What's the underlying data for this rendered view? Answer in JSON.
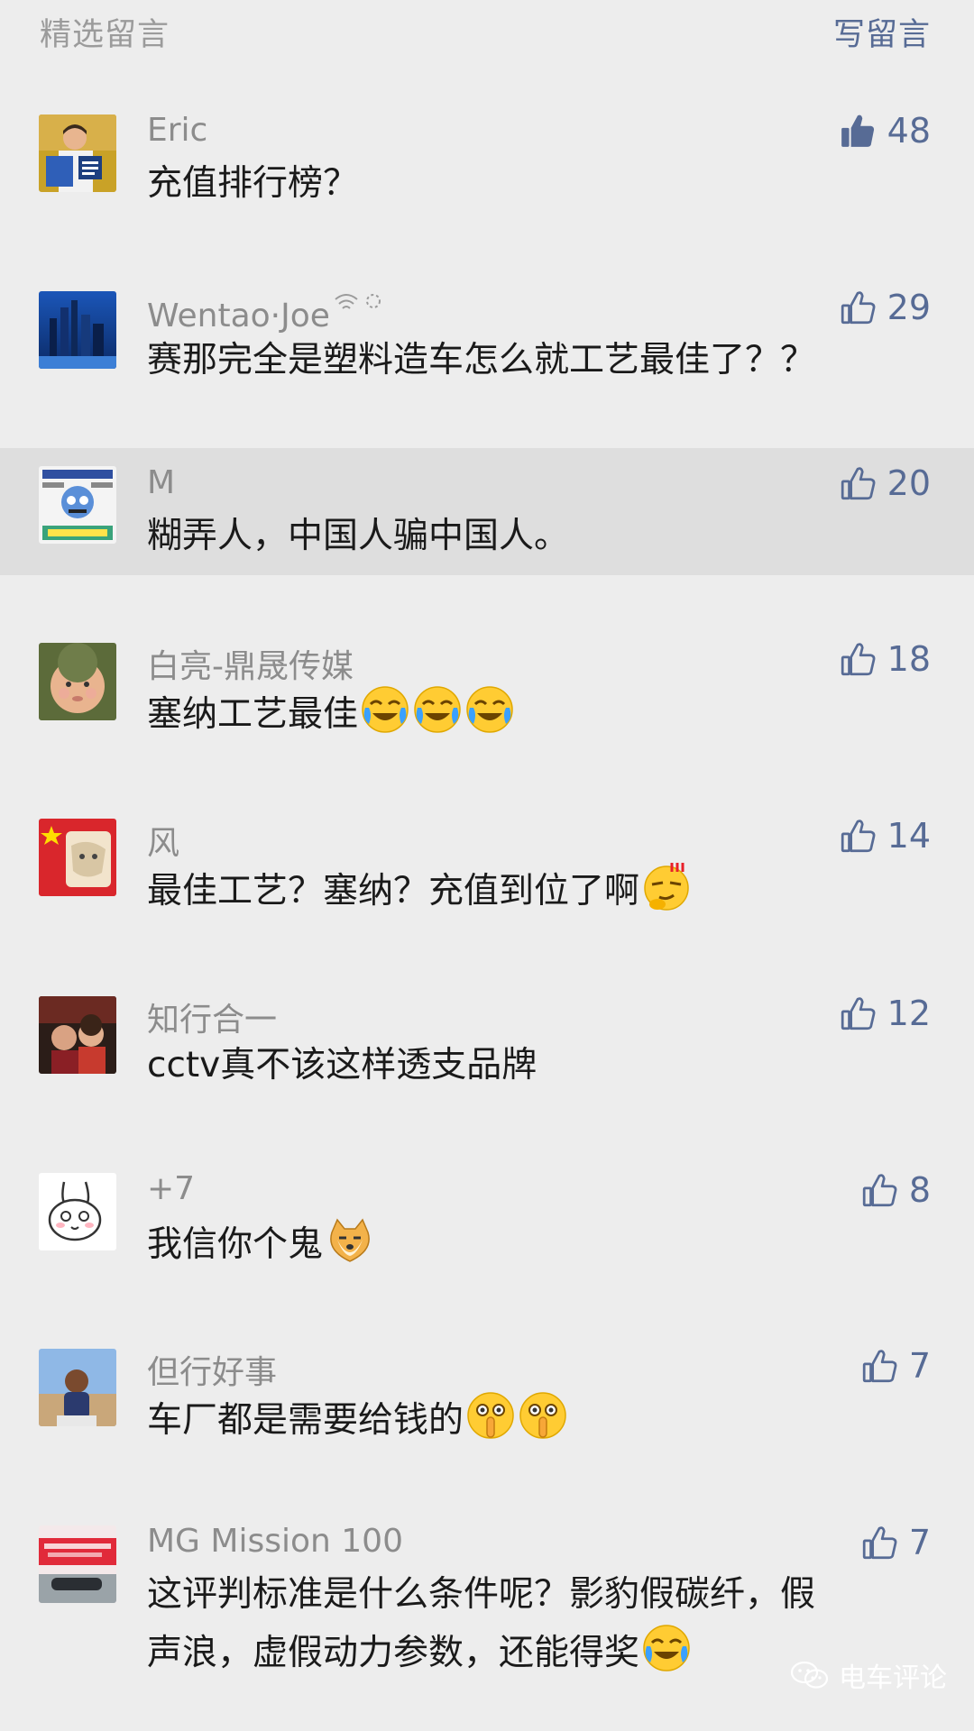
{
  "header": {
    "title": "精选留言",
    "write_label": "写留言"
  },
  "comments": [
    {
      "nickname": "Eric",
      "text": "充值排行榜？",
      "likes": "48",
      "liked": true
    },
    {
      "nickname": "Wentao·Joe",
      "text": "赛那完全是塑料造车怎么就工艺最佳了？？",
      "likes": "29",
      "liked": false
    },
    {
      "nickname": "M",
      "text": "糊弄人，中国人骗中国人。",
      "likes": "20",
      "liked": false
    },
    {
      "nickname": "白亮-鼎晟传媒",
      "text": "塞纳工艺最佳",
      "likes": "18",
      "liked": false
    },
    {
      "nickname": "风",
      "text": "最佳工艺？塞纳？充值到位了啊",
      "likes": "14",
      "liked": false
    },
    {
      "nickname": "知行合一",
      "text": "cctv真不该这样透支品牌",
      "likes": "12",
      "liked": false
    },
    {
      "nickname": "+7",
      "text": "我信你个鬼",
      "likes": "8",
      "liked": false
    },
    {
      "nickname": "但行好事",
      "text": "车厂都是需要给钱的",
      "likes": "7",
      "liked": false
    },
    {
      "nickname": "MG Mission 100",
      "text_line1": "这评判标准是什么条件呢？影豹假碳纤，假",
      "text_line2": "声浪，虚假动力参数，还能得奖",
      "likes": "7",
      "liked": false
    }
  ],
  "watermark": "电车评论",
  "colors": {
    "background": "#ededed",
    "highlight_row": "#dedede",
    "link_blue": "#576b95",
    "nickname_gray": "#8c8c8c"
  }
}
